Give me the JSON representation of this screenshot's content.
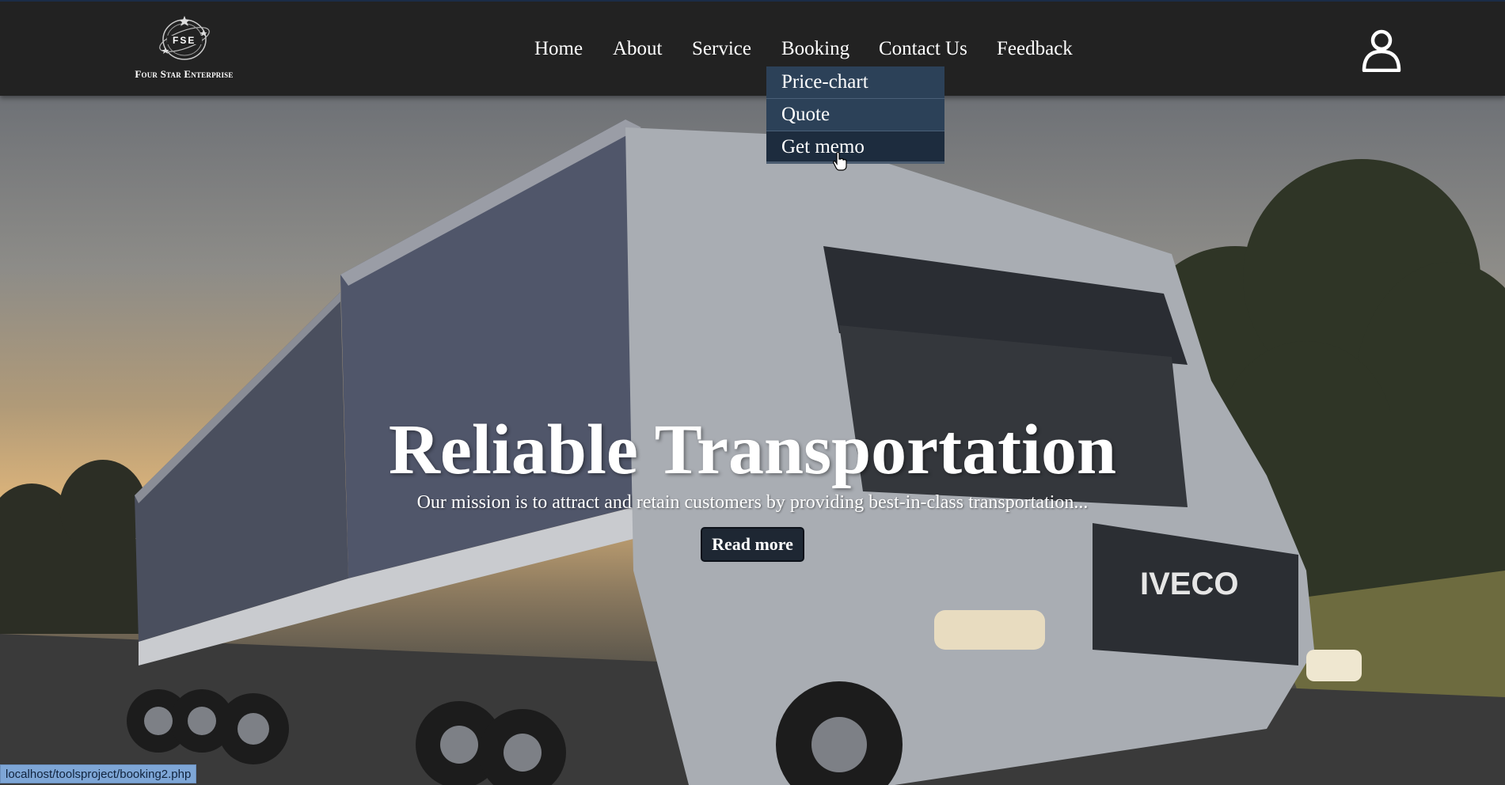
{
  "brand": {
    "name": "Four Star Enterprise",
    "monogram": "FSE"
  },
  "nav": {
    "items": [
      {
        "label": "Home"
      },
      {
        "label": "About"
      },
      {
        "label": "Service"
      },
      {
        "label": "Booking"
      },
      {
        "label": "Contact Us"
      },
      {
        "label": "Feedback"
      }
    ],
    "user_icon": "user-icon"
  },
  "booking_dropdown": {
    "items": [
      {
        "label": "Price-chart"
      },
      {
        "label": "Quote"
      },
      {
        "label": "Get memo"
      }
    ],
    "hovered": "Get memo"
  },
  "hero": {
    "title": "Reliable Transportation",
    "subtitle": "Our mission is to attract and retain customers by providing best-in-class transportation...",
    "button_label": "Read more",
    "truck_badge": "IVECO"
  },
  "status_bar": {
    "url": "localhost/toolsproject/booking2.php"
  },
  "colors": {
    "navbar_bg": "#222222",
    "dropdown_bg": "#2c4158",
    "dropdown_hover_bg": "#1d2c3e",
    "button_bg": "#1e2733",
    "status_bar_bg": "#7ea6d6"
  }
}
